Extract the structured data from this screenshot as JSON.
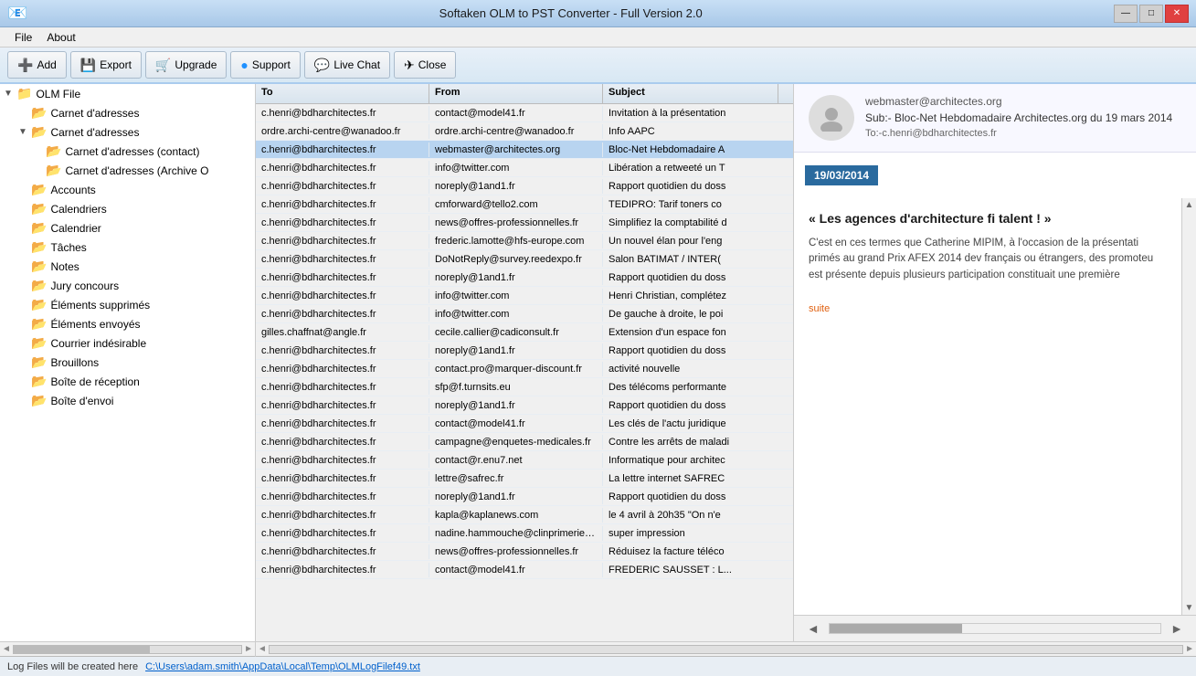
{
  "window": {
    "title": "Softaken OLM to PST Converter - Full Version 2.0",
    "icon": "📧"
  },
  "titlebar": {
    "minimize": "—",
    "maximize": "□",
    "close": "✕"
  },
  "menu": {
    "items": [
      "File",
      "About"
    ]
  },
  "toolbar": {
    "buttons": [
      {
        "id": "add",
        "label": "Add",
        "icon": "➕"
      },
      {
        "id": "export",
        "label": "Export",
        "icon": "💾"
      },
      {
        "id": "upgrade",
        "label": "Upgrade",
        "icon": "🛒"
      },
      {
        "id": "support",
        "label": "Support",
        "icon": "🔵"
      },
      {
        "id": "livechat",
        "label": "Live Chat",
        "icon": "💬"
      },
      {
        "id": "close",
        "label": "Close",
        "icon": "✈"
      }
    ]
  },
  "sidebar": {
    "items": [
      {
        "id": "olm-file",
        "label": "OLM File",
        "indent": 0,
        "expand": "▼",
        "icon": "📁",
        "type": "root"
      },
      {
        "id": "carnet1",
        "label": "Carnet d'adresses",
        "indent": 1,
        "expand": "",
        "icon": "📂"
      },
      {
        "id": "carnet2",
        "label": "Carnet d'adresses",
        "indent": 1,
        "expand": "▼",
        "icon": "📂"
      },
      {
        "id": "carnet-contact",
        "label": "Carnet d'adresses  (contact)",
        "indent": 2,
        "expand": "",
        "icon": "📂"
      },
      {
        "id": "carnet-archive",
        "label": "Carnet d'adresses  (Archive O",
        "indent": 2,
        "expand": "",
        "icon": "📂"
      },
      {
        "id": "accounts",
        "label": "Accounts",
        "indent": 1,
        "expand": "",
        "icon": "📂"
      },
      {
        "id": "calendriers",
        "label": "Calendriers",
        "indent": 1,
        "expand": "",
        "icon": "📂"
      },
      {
        "id": "calendrier",
        "label": "Calendrier",
        "indent": 1,
        "expand": "",
        "icon": "📂"
      },
      {
        "id": "taches",
        "label": "Tâches",
        "indent": 1,
        "expand": "",
        "icon": "📂"
      },
      {
        "id": "notes",
        "label": "Notes",
        "indent": 1,
        "expand": "",
        "icon": "📂"
      },
      {
        "id": "jury",
        "label": "Jury concours",
        "indent": 1,
        "expand": "",
        "icon": "📂"
      },
      {
        "id": "elements-suppr",
        "label": "Éléments supprimés",
        "indent": 1,
        "expand": "",
        "icon": "📂"
      },
      {
        "id": "elements-envoyes",
        "label": "Éléments envoyés",
        "indent": 1,
        "expand": "",
        "icon": "📂"
      },
      {
        "id": "courrier",
        "label": "Courrier indésirable",
        "indent": 1,
        "expand": "",
        "icon": "📂"
      },
      {
        "id": "brouillons",
        "label": "Brouillons",
        "indent": 1,
        "expand": "",
        "icon": "📂"
      },
      {
        "id": "boite-reception",
        "label": "Boîte de réception",
        "indent": 1,
        "expand": "",
        "icon": "📂"
      },
      {
        "id": "boite-envoi",
        "label": "Boîte d'envoi",
        "indent": 1,
        "expand": "",
        "icon": "📂"
      }
    ]
  },
  "email_list": {
    "columns": [
      "To",
      "From",
      "Subject"
    ],
    "rows": [
      {
        "to": "c.henri@bdharchitectes.fr",
        "from": "contact@model41.fr",
        "subject": "Invitation à la présentation"
      },
      {
        "to": "ordre.archi-centre@wanadoo.fr",
        "from": "ordre.archi-centre@wanadoo.fr",
        "subject": "Info AAPC"
      },
      {
        "to": "c.henri@bdharchitectes.fr",
        "from": "webmaster@architectes.org",
        "subject": "Bloc-Net Hebdomadaire A"
      },
      {
        "to": "c.henri@bdharchitectes.fr",
        "from": "info@twitter.com",
        "subject": "Libération a retweeté un T"
      },
      {
        "to": "c.henri@bdharchitectes.fr",
        "from": "noreply@1and1.fr",
        "subject": "Rapport quotidien du doss"
      },
      {
        "to": "c.henri@bdharchitectes.fr",
        "from": "cmforward@tello2.com",
        "subject": "TEDIPRO: Tarif toners co"
      },
      {
        "to": "c.henri@bdharchitectes.fr",
        "from": "news@offres-professionnelles.fr",
        "subject": "Simplifiez la comptabilité d"
      },
      {
        "to": "c.henri@bdharchitectes.fr",
        "from": "frederic.lamotte@hfs-europe.com",
        "subject": "Un nouvel élan pour l'eng"
      },
      {
        "to": "c.henri@bdharchitectes.fr",
        "from": "DoNotReply@survey.reedexpo.fr",
        "subject": "Salon BATIMAT / INTER("
      },
      {
        "to": "c.henri@bdharchitectes.fr",
        "from": "noreply@1and1.fr",
        "subject": "Rapport quotidien du doss"
      },
      {
        "to": "c.henri@bdharchitectes.fr",
        "from": "info@twitter.com",
        "subject": "Henri Christian, complétez"
      },
      {
        "to": "c.henri@bdharchitectes.fr",
        "from": "info@twitter.com",
        "subject": "De gauche à droite, le poi"
      },
      {
        "to": "gilles.chaffnat@angle.fr",
        "from": "cecile.callier@cadiconsult.fr",
        "subject": "Extension d'un espace fon"
      },
      {
        "to": "c.henri@bdharchitectes.fr",
        "from": "noreply@1and1.fr",
        "subject": "Rapport quotidien du doss"
      },
      {
        "to": "c.henri@bdharchitectes.fr",
        "from": "contact.pro@marquer-discount.fr",
        "subject": "activité nouvelle"
      },
      {
        "to": "c.henri@bdharchitectes.fr",
        "from": "sfp@f.turnsits.eu",
        "subject": "Des télécoms performante"
      },
      {
        "to": "c.henri@bdharchitectes.fr",
        "from": "noreply@1and1.fr",
        "subject": "Rapport quotidien du doss"
      },
      {
        "to": "c.henri@bdharchitectes.fr",
        "from": "contact@model41.fr",
        "subject": "Les clés de l'actu juridique"
      },
      {
        "to": "c.henri@bdharchitectes.fr",
        "from": "campagne@enquetes-medicales.fr",
        "subject": "Contre les arrêts de maladi"
      },
      {
        "to": "c.henri@bdharchitectes.fr",
        "from": "contact@r.enu7.net",
        "subject": "Informatique pour architec"
      },
      {
        "to": "c.henri@bdharchitectes.fr",
        "from": "lettre@safrec.fr",
        "subject": "La lettre internet SAFREC"
      },
      {
        "to": "c.henri@bdharchitectes.fr",
        "from": "noreply@1and1.fr",
        "subject": "Rapport quotidien du doss"
      },
      {
        "to": "c.henri@bdharchitectes.fr",
        "from": "kapla@kaplanews.com",
        "subject": "le 4 avril à 20h35  \"On n'e"
      },
      {
        "to": "c.henri@bdharchitectes.fr",
        "from": "nadine.hammouche@clinprimerie.co",
        "subject": "super  impression"
      },
      {
        "to": "c.henri@bdharchitectes.fr",
        "from": "news@offres-professionnelles.fr",
        "subject": "Réduisez la facture téléco"
      },
      {
        "to": "c.henri@bdharchitectes.fr",
        "from": "contact@model41.fr",
        "subject": "FREDERIC SAUSSET : L..."
      }
    ]
  },
  "preview": {
    "from_email": "webmaster@architectes.org",
    "subject": "Sub:- Bloc-Net Hebdomadaire Architectes.org du 19 mars 2014",
    "to": "To:-c.henri@bdharchitectes.fr",
    "date_badge": "19/03/2014",
    "article_title": "« Les agences d'architecture fi talent ! »",
    "article_text": "C'est en ces termes que Catherine MIPIM, à l'occasion de la présentati primés au grand Prix AFEX 2014 dev français ou étrangers, des promoteu est présente depuis plusieurs participation constituait une première",
    "read_more": "suite"
  },
  "status_bar": {
    "text": "Log Files will be created here",
    "link": "C:\\Users\\adam.smith\\AppData\\Local\\Temp\\OLMLogFilef49.txt"
  }
}
